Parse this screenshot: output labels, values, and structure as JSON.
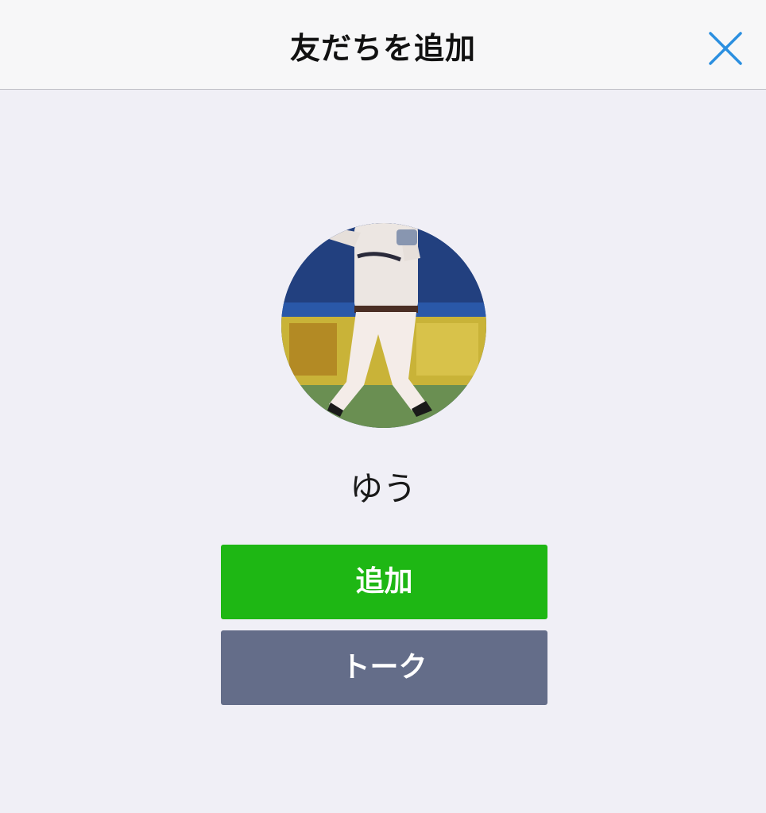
{
  "header": {
    "title": "友だちを追加",
    "close_icon": "close-icon"
  },
  "profile": {
    "name": "ゆう",
    "avatar_icon": "avatar-photo"
  },
  "buttons": {
    "add_label": "追加",
    "talk_label": "トーク"
  },
  "colors": {
    "accent_blue": "#2b8fe0",
    "add_green": "#1eb714",
    "talk_slate": "#646d89",
    "background": "#f0eff6"
  }
}
